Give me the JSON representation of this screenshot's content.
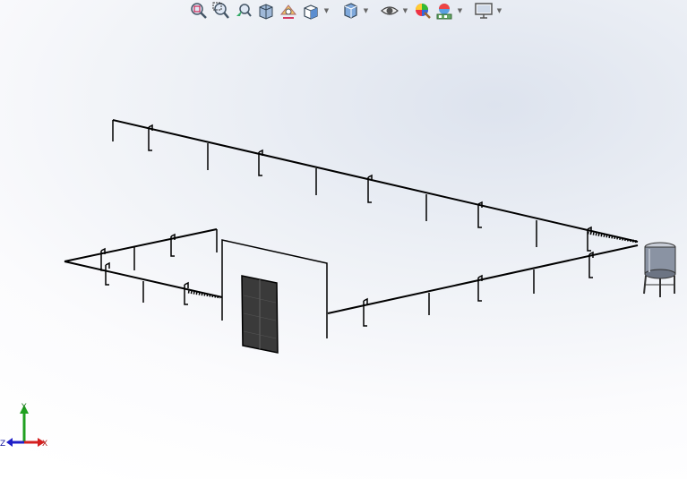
{
  "toolbar": {
    "items": [
      {
        "icon": "zoom-to-fit-icon",
        "dropdown": false
      },
      {
        "icon": "zoom-to-area-icon",
        "dropdown": false
      },
      {
        "icon": "previous-view-icon",
        "dropdown": false
      },
      {
        "icon": "section-view-icon",
        "dropdown": false
      },
      {
        "icon": "dynamic-annotation-view-icon",
        "dropdown": false
      },
      {
        "icon": "view-orientation-icon",
        "dropdown": true
      },
      {
        "icon": "display-style-icon",
        "dropdown": true
      },
      {
        "icon": "hide-show-items-icon",
        "dropdown": true
      },
      {
        "icon": "edit-appearance-icon",
        "dropdown": false
      },
      {
        "icon": "apply-scene-icon",
        "dropdown": true
      },
      {
        "icon": "view-settings-icon",
        "dropdown": true
      }
    ]
  },
  "triad": {
    "x_label": "X",
    "y_label": "Y",
    "z_label": "Z",
    "colors": {
      "x": "#d42020",
      "y": "#20a020",
      "z": "#2020c8"
    }
  },
  "model": {
    "line_color": "#000000",
    "door_color": "#3a3a3a",
    "tank_color": "#8a93a3"
  }
}
